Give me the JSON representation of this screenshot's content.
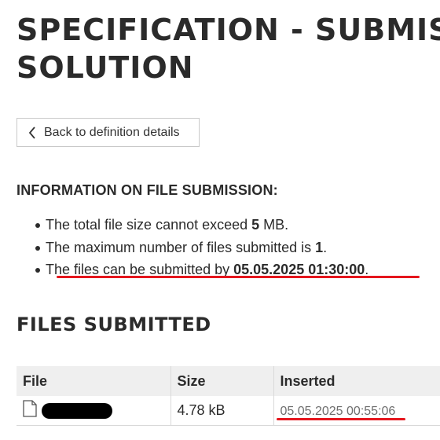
{
  "page": {
    "title_line1": "SPECIFICATION - SUBMISSION",
    "title_line2": "SOLUTION"
  },
  "back_button": {
    "label": "Back to definition details",
    "icon": "chevron-left-icon"
  },
  "info": {
    "heading": "INFORMATION ON FILE SUBMISSION:",
    "items": [
      {
        "prefix": "The total file size cannot exceed ",
        "value": "5",
        "suffix": " MB."
      },
      {
        "prefix": "The maximum number of files submitted is ",
        "value": "1",
        "suffix": "."
      },
      {
        "prefix": "The files can be submitted by ",
        "value": "05.05.2025 01:30:00",
        "suffix": "."
      }
    ]
  },
  "files": {
    "heading": "FILES SUBMITTED",
    "columns": [
      "File",
      "Size",
      "Inserted"
    ],
    "rows": [
      {
        "file_icon": "document-icon",
        "file_name_redacted": true,
        "size": "4.78 kB",
        "inserted": "05.05.2025 00:55:06"
      }
    ]
  },
  "annotations": {
    "underline_color": "#e5161d"
  }
}
